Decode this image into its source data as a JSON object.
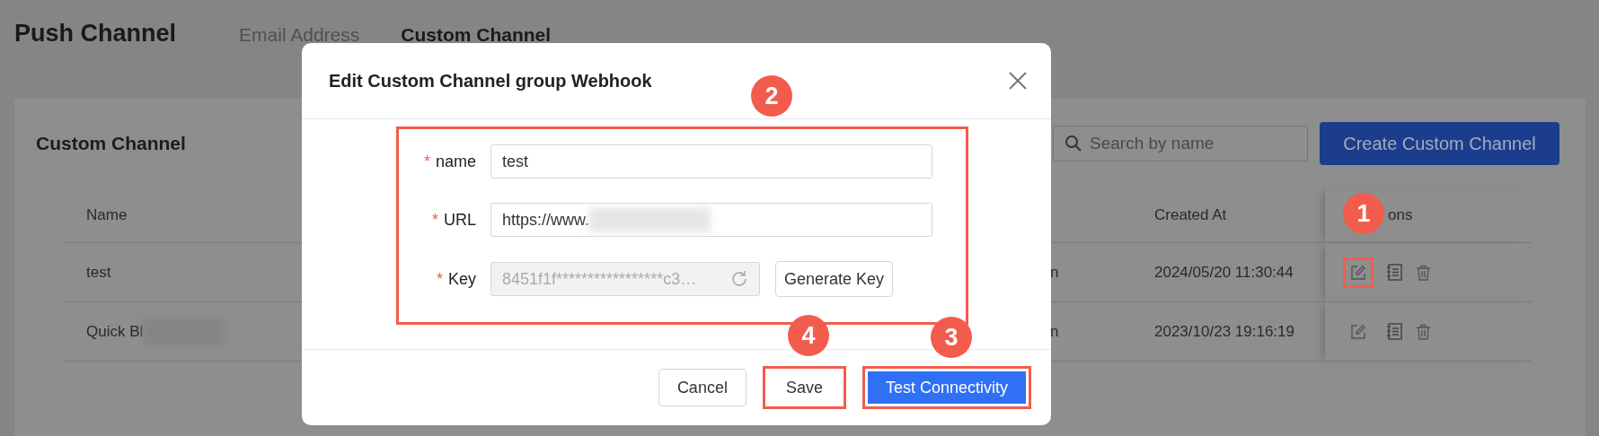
{
  "page": {
    "title": "Push Channel",
    "tabs": [
      {
        "label": "Email Address",
        "selected": false
      },
      {
        "label": "Custom Channel",
        "selected": true
      }
    ]
  },
  "card": {
    "title": "Custom Channel",
    "search": {
      "placeholder": "Search by name"
    },
    "create_button": "Create Custom Channel",
    "table": {
      "columns": [
        "Name",
        "Created At",
        "ons"
      ],
      "rows": [
        {
          "name": "test",
          "name_redacted": false,
          "column_2": "n",
          "created_at": "2024/05/20 11:30:44",
          "edit_highlighted": true
        },
        {
          "name": "Quick Bl",
          "name_redacted": true,
          "column_2": "n",
          "created_at": "2023/10/23 19:16:19",
          "edit_highlighted": false
        }
      ]
    }
  },
  "dialog": {
    "title": "Edit Custom Channel group Webhook",
    "form_highlighted": true,
    "fields": [
      {
        "kind": "text",
        "label": "name",
        "required_mark": "*",
        "value": "test",
        "redacted": false
      },
      {
        "kind": "text",
        "label": "URL",
        "required_mark": "*",
        "value": "https://www.",
        "redacted": true
      },
      {
        "kind": "key",
        "label": "Key",
        "required_mark": "*",
        "value": "8451f1f*****************c3…",
        "disabled": true,
        "button": "Generate Key"
      }
    ],
    "buttons": [
      {
        "kind": "default",
        "label": "Cancel",
        "highlighted": false
      },
      {
        "kind": "default",
        "label": "Save",
        "highlighted": true
      },
      {
        "kind": "primary",
        "label": "Test Connectivity",
        "highlighted": true
      }
    ]
  },
  "annotations": [
    {
      "label": "1"
    },
    {
      "label": "2"
    },
    {
      "label": "3"
    },
    {
      "label": "4"
    }
  ]
}
